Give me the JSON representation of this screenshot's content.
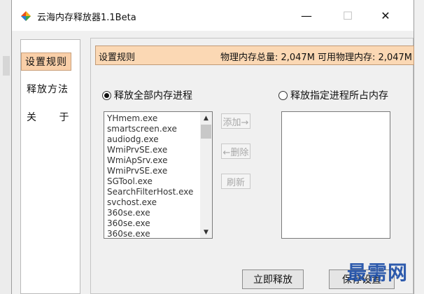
{
  "window": {
    "title": "云海内存释放器1.1Beta",
    "min_symbol": "—",
    "max_symbol": "☐",
    "close_symbol": "✕"
  },
  "nav": {
    "items": [
      {
        "label": "设置规则",
        "selected": true
      },
      {
        "label": "释放方法",
        "selected": false
      },
      {
        "label": "关 于",
        "selected": false
      }
    ]
  },
  "header": {
    "title": "设置规则",
    "memory_info": "物理内存总量: 2,047M  可用物理内存: 2,047M"
  },
  "options": {
    "all_processes": {
      "label": "释放全部内存进程",
      "checked": true
    },
    "specific_processes": {
      "label": "释放指定进程所占内存",
      "checked": false
    }
  },
  "process_list": [
    "YHmem.exe",
    "smartscreen.exe",
    "audiodg.exe",
    "WmiPrvSE.exe",
    "WmiApSrv.exe",
    "WmiPrvSE.exe",
    "SGTool.exe",
    "SearchFilterHost.exe",
    "svchost.exe",
    "360se.exe",
    "360se.exe",
    "360se.exe"
  ],
  "buttons": {
    "add": "添加→",
    "remove": "←删除",
    "refresh": "刷新",
    "release_now": "立即释放",
    "save": "保存设置"
  },
  "watermark": "最需网",
  "colors": {
    "accent_bg": "#fbd8b4",
    "nav_selected_bg": "#f9cfa8",
    "watermark": "#1e4fa8"
  }
}
